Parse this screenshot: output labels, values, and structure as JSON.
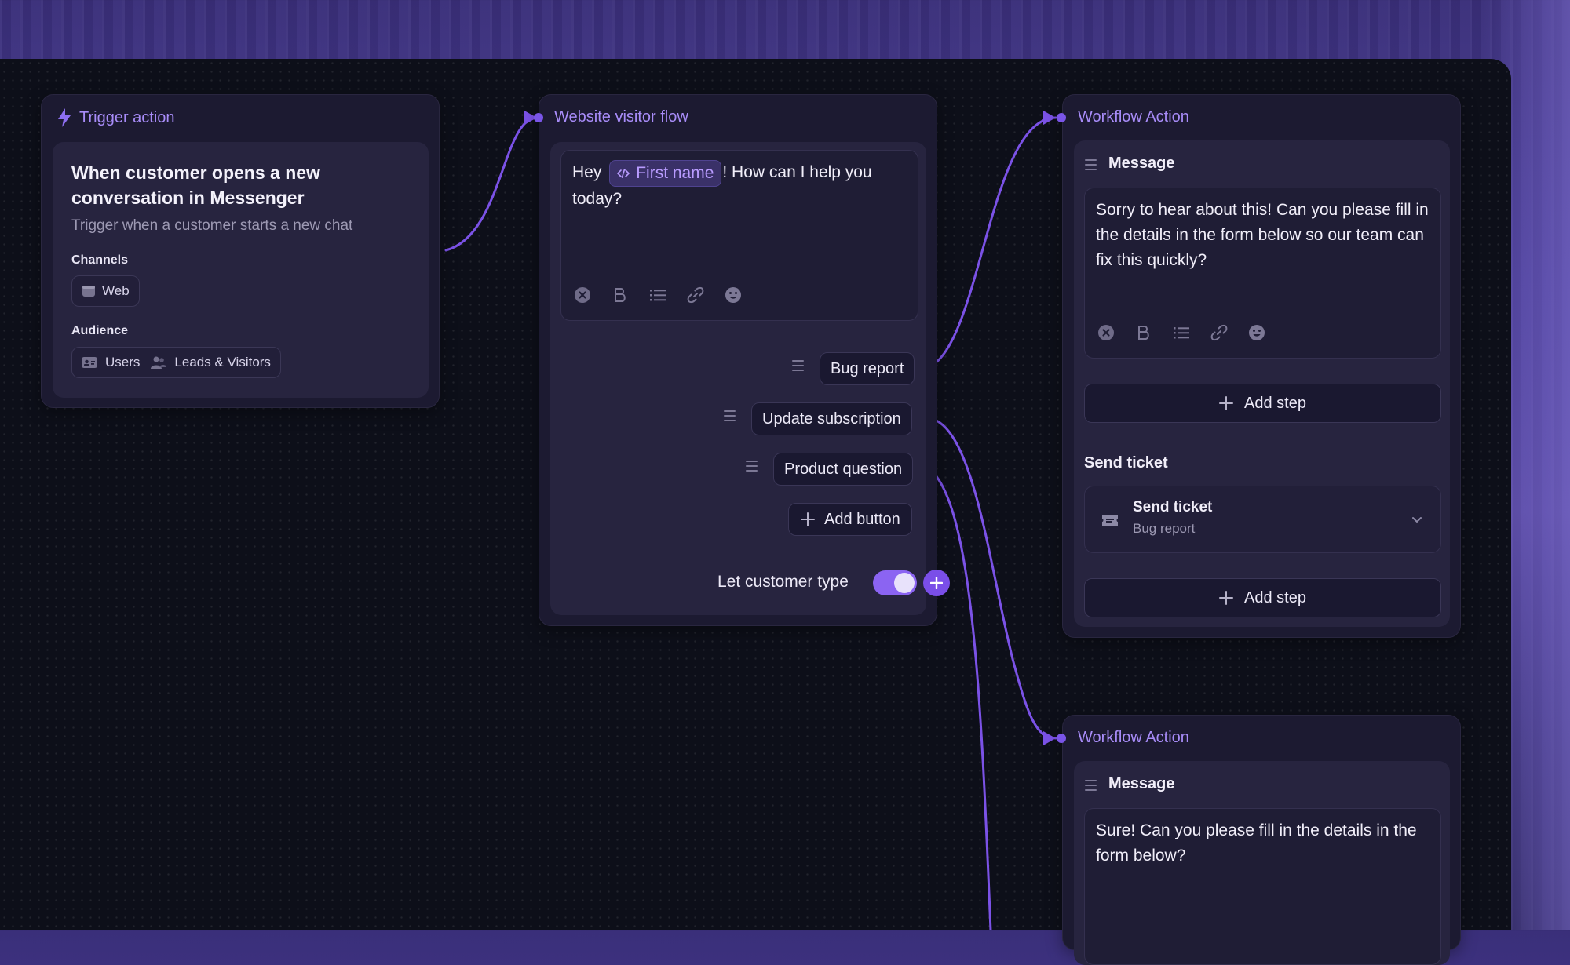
{
  "trigger": {
    "header": "Trigger action",
    "title_line1": "When customer opens a new",
    "title_line2": "conversation in Messenger",
    "subtitle": "Trigger when a customer starts a new chat",
    "channels_label": "Channels",
    "channels": [
      "Web"
    ],
    "audience_label": "Audience",
    "audience": [
      "Users",
      "Leads & Visitors"
    ]
  },
  "visitor_flow": {
    "header": "Website visitor flow",
    "message_prefix": "Hey",
    "variable_chip": "First name",
    "message_suffix_line1": "! How can I help you",
    "message_suffix_line2": "today?",
    "buttons": [
      "Bug report",
      "Update subscription",
      "Product question"
    ],
    "add_button_label": "Add button",
    "let_type_label": "Let customer type",
    "let_type_enabled": true
  },
  "workflow_action_1": {
    "header": "Workflow Action",
    "message_label": "Message",
    "message_text": "Sorry to hear about this! Can you please fill in the details in the form below so our team can fix this quickly?",
    "add_step_label": "Add step",
    "send_ticket_section": "Send ticket",
    "ticket_title": "Send ticket",
    "ticket_subtitle": "Bug report",
    "add_step_label_2": "Add step"
  },
  "workflow_action_2": {
    "header": "Workflow Action",
    "message_label": "Message",
    "message_text": "Sure! Can you please fill in the details in the form below?"
  },
  "icons": [
    "bolt-icon",
    "code-icon",
    "clear-icon",
    "bold-icon",
    "list-icon",
    "link-icon",
    "emoji-icon",
    "drag-handle-icon",
    "plus-icon",
    "chevron-down-icon",
    "ticket-icon",
    "browser-icon",
    "user-card-icon",
    "users-icon"
  ],
  "colors": {
    "accent": "#a88cf8",
    "wire": "#7b52e6",
    "canvas": "#0d0f19",
    "card": "#1c1a31",
    "inner": "#27243f"
  }
}
